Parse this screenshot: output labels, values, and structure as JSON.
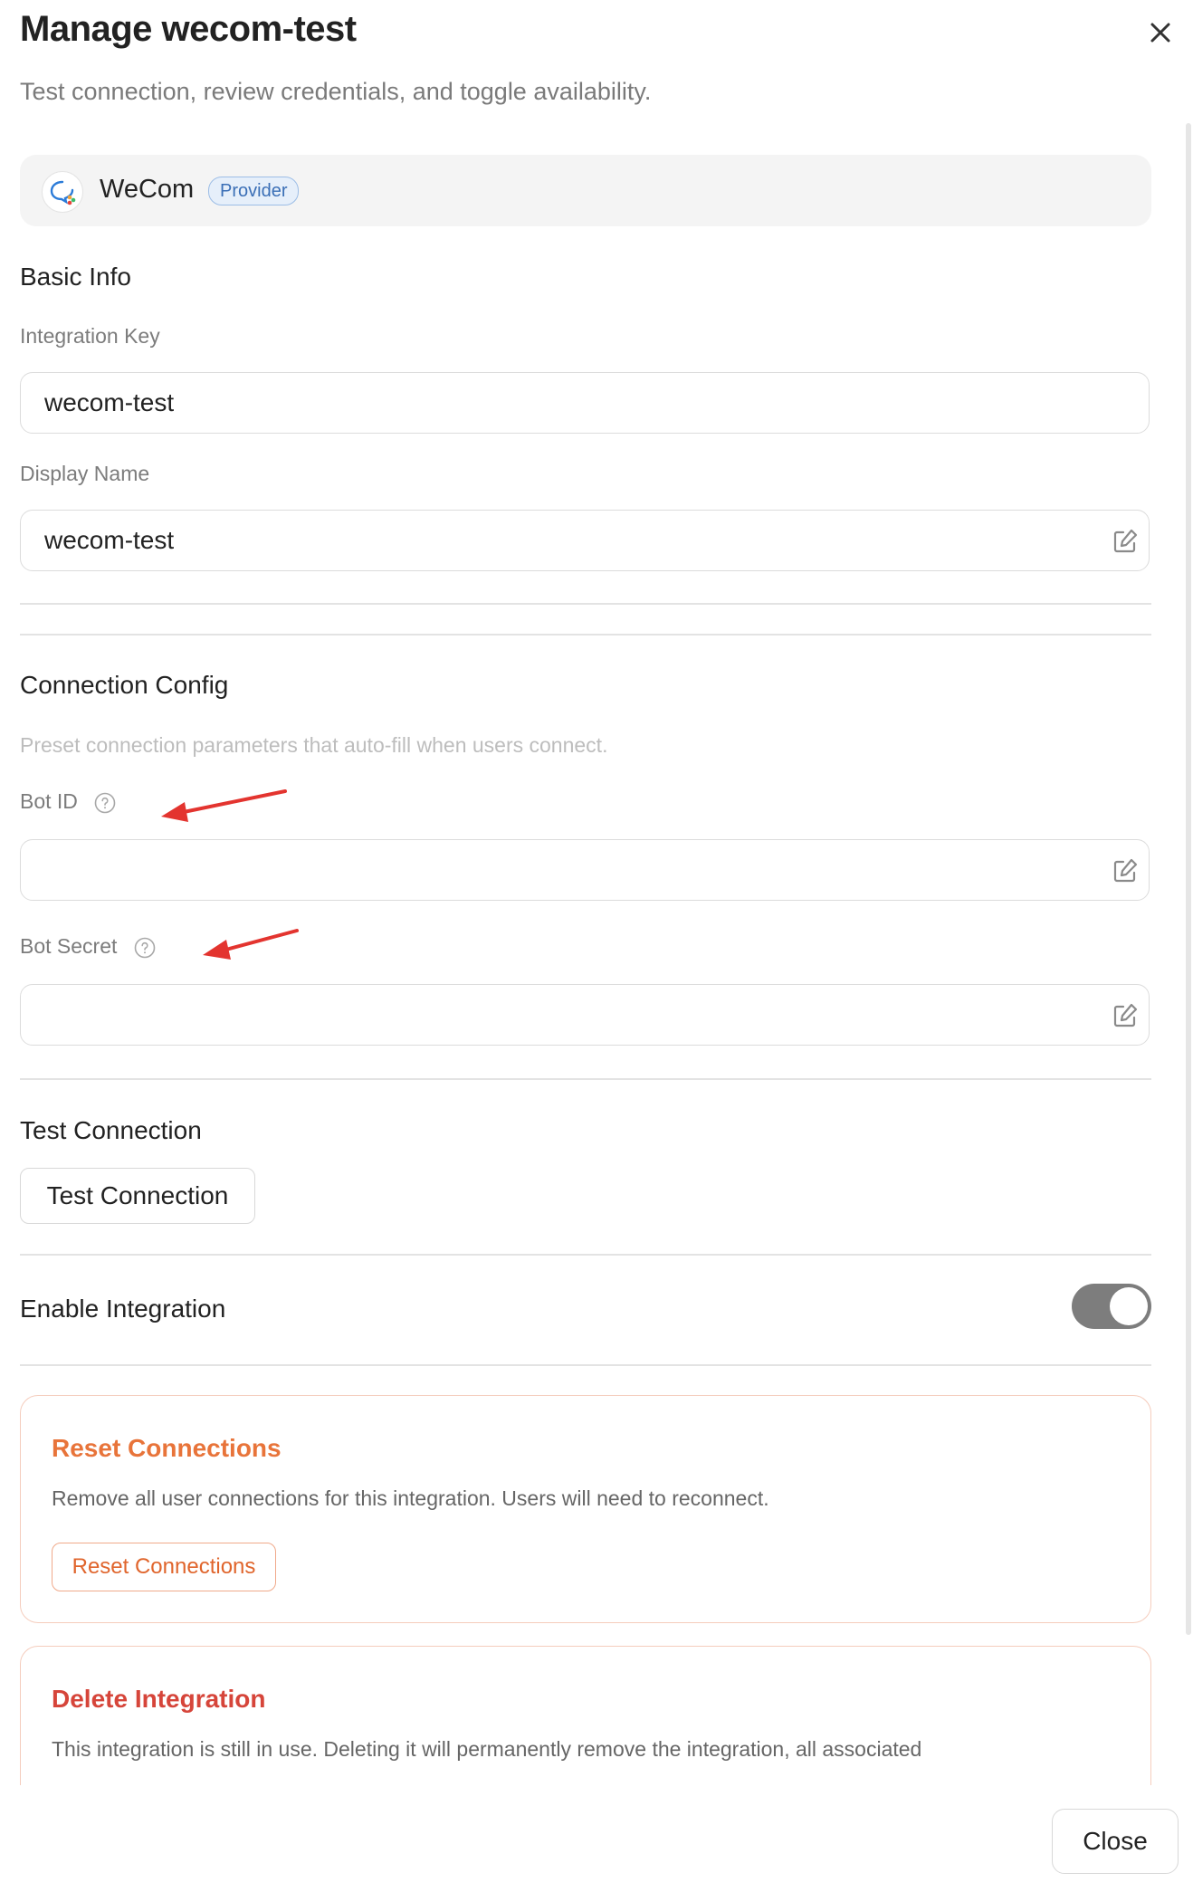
{
  "dialog": {
    "title": "Manage wecom-test",
    "subtitle": "Test connection, review credentials, and toggle availability."
  },
  "provider": {
    "name": "WeCom",
    "badge": "Provider"
  },
  "basic_info": {
    "heading": "Basic Info",
    "integration_key_label": "Integration Key",
    "integration_key_value": "wecom-test",
    "display_name_label": "Display Name",
    "display_name_value": "wecom-test"
  },
  "connection_config": {
    "heading": "Connection Config",
    "description": "Preset connection parameters that auto-fill when users connect.",
    "bot_id_label": "Bot ID",
    "bot_id_value": "",
    "bot_secret_label": "Bot Secret",
    "bot_secret_value": ""
  },
  "test_connection": {
    "heading": "Test Connection",
    "button_label": "Test Connection"
  },
  "enable_integration": {
    "label": "Enable Integration",
    "enabled": true
  },
  "reset_connections": {
    "title": "Reset Connections",
    "description": "Remove all user connections for this integration. Users will need to reconnect.",
    "button_label": "Reset Connections"
  },
  "delete_integration": {
    "title": "Delete Integration",
    "description": "This integration is still in use. Deleting it will permanently remove the integration, all associated"
  },
  "footer": {
    "close_label": "Close"
  },
  "colors": {
    "accent_orange": "#e8743a",
    "danger_red": "#d6453a",
    "annotation_arrow": "#e3342f",
    "toggle_on": "#7d7d7d"
  }
}
